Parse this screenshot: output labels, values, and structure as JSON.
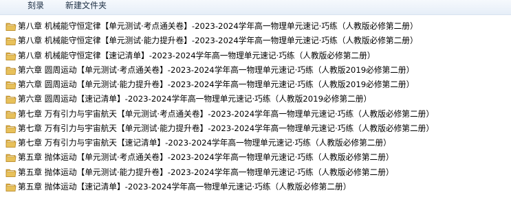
{
  "toolbar": {
    "burn_label": "刻录",
    "new_folder_label": "新建文件夹"
  },
  "icons": {
    "folder": "folder-icon"
  },
  "colors": {
    "folder_body": "#e8c15a",
    "folder_back": "#d7a83a",
    "folder_edge": "#b8892a",
    "toolbar_bg": "#eef3fa"
  },
  "files": [
    {
      "name": "第八章  机械能守恒定律【单元测试·考点通关卷】-2023-2024学年高一物理单元速记·巧练（人教版必修第二册）"
    },
    {
      "name": "第八章  机械能守恒定律【单元测试·能力提升卷】-2023-2024学年高一物理单元速记·巧练（人教版必修第二册）"
    },
    {
      "name": "第八章  机械能守恒定律【速记清单】-2023-2024学年高一物理单元速记·巧练（人教版必修第二册）"
    },
    {
      "name": "第六章  圆周运动【单元测试·考点通关卷】-2023-2024学年高一物理单元速记·巧练（人教版2019必修第二册）"
    },
    {
      "name": "第六章  圆周运动【单元测试·能力提升卷】-2023-2024学年高一物理单元速记·巧练（人教版2019必修第二册）"
    },
    {
      "name": "第六章  圆周运动【速记清单】-2023-2024学年高一物理单元速记·巧练（人教版2019必修第二册）"
    },
    {
      "name": "第七章  万有引力与宇宙航天【单元测试·考点通关卷】-2023-2024学年高一物理单元速记·巧练（人教版必修第二册）"
    },
    {
      "name": "第七章  万有引力与宇宙航天【单元测试·能力提升卷】-2023-2024学年高一物理单元速记·巧练（人教版必修第二册）"
    },
    {
      "name": "第七章  万有引力与宇宙航天【速记清单】-2023-2024学年高一物理单元速记·巧练（人教版必修第二册）"
    },
    {
      "name": "第五章  抛体运动【单元测试·考点通关卷】-2023-2024学年高一物理单元速记·巧练（人教版必修第二册）"
    },
    {
      "name": "第五章  抛体运动【单元测试·能力提升卷】-2023-2024学年高一物理单元速记·巧练（人教版必修第二册）"
    },
    {
      "name": "第五章  抛体运动【速记清单】-2023-2024学年高一物理单元速记·巧练（人教版必修第二册）"
    }
  ]
}
